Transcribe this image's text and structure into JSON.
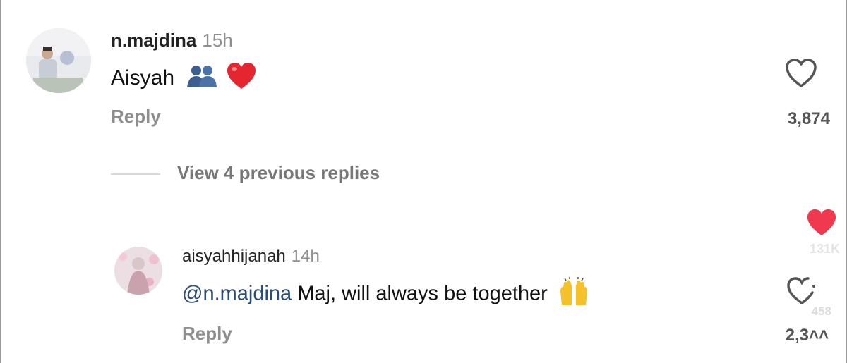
{
  "comments": [
    {
      "username": "n.majdina",
      "time": "15h",
      "text": "Aisyah",
      "reply_label": "Reply",
      "like_count": "3,874",
      "liked": false
    },
    {
      "username": "aisyahhijanah",
      "time": "14h",
      "mention": "@n.majdina",
      "text": " Maj, will always be together",
      "reply_label": "Reply",
      "like_count": "2,3˄˄",
      "liked": false
    }
  ],
  "view_replies_label": "View 4 previous replies",
  "overlay_like": {
    "count": "131K",
    "liked": true
  },
  "overlay_secondary_count": "458",
  "colors": {
    "heart_filled": "#f0384e",
    "mention": "#2a4d7a",
    "muted": "#8e8e8e"
  },
  "icons": [
    "heart-outline-icon",
    "heart-filled-icon",
    "people-emoji-icon",
    "red-heart-emoji-icon",
    "raising-hands-emoji-icon"
  ]
}
